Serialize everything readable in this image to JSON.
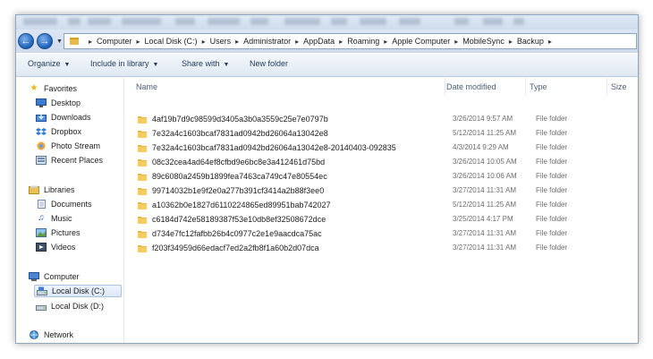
{
  "address": {
    "crumbs": [
      "Computer",
      "Local Disk (C:)",
      "Users",
      "Administrator",
      "AppData",
      "Roaming",
      "Apple Computer",
      "MobileSync",
      "Backup"
    ]
  },
  "toolbar": {
    "organize_label": "Organize",
    "include_label": "Include in library",
    "share_label": "Share with",
    "new_folder_label": "New folder"
  },
  "sidebar": {
    "favorites_label": "Favorites",
    "favorites": [
      {
        "label": "Desktop",
        "icon": "desktop-icon"
      },
      {
        "label": "Downloads",
        "icon": "downloads-icon"
      },
      {
        "label": "Dropbox",
        "icon": "dropbox-icon"
      },
      {
        "label": "Photo Stream",
        "icon": "photo-stream-icon"
      },
      {
        "label": "Recent Places",
        "icon": "recent-places-icon"
      }
    ],
    "libraries_label": "Libraries",
    "libraries": [
      {
        "label": "Documents",
        "icon": "documents-icon"
      },
      {
        "label": "Music",
        "icon": "music-icon"
      },
      {
        "label": "Pictures",
        "icon": "pictures-icon"
      },
      {
        "label": "Videos",
        "icon": "videos-icon"
      }
    ],
    "computer_label": "Computer",
    "computer": [
      {
        "label": "Local Disk (C:)",
        "icon": "drive-icon",
        "selected": true
      },
      {
        "label": "Local Disk (D:)",
        "icon": "drive-icon",
        "selected": false
      }
    ],
    "network_label": "Network"
  },
  "columns": {
    "name": "Name",
    "date": "Date modified",
    "type": "Type",
    "size": "Size"
  },
  "files": [
    {
      "name": "4af19b7d9c98599d3405a3b0a3559c25e7e0797b",
      "date": "3/26/2014 9:57 AM",
      "type": "File folder"
    },
    {
      "name": "7e32a4c1603bcaf7831ad0942bd26064a13042e8",
      "date": "5/12/2014 11:25 AM",
      "type": "File folder"
    },
    {
      "name": "7e32a4c1603bcaf7831ad0942bd26064a13042e8-20140403-092835",
      "date": "4/3/2014 9:29 AM",
      "type": "File folder"
    },
    {
      "name": "08c32cea4ad64ef8cfbd9e6bc8e3a412461d75bd",
      "date": "3/26/2014 10:05 AM",
      "type": "File folder"
    },
    {
      "name": "89c6080a2459b1899fea7463ca749c47e80554ec",
      "date": "3/26/2014 10:06 AM",
      "type": "File folder"
    },
    {
      "name": "99714032b1e9f2e0a277b391cf3414a2b88f3ee0",
      "date": "3/27/2014 11:31 AM",
      "type": "File folder"
    },
    {
      "name": "a10362b0e1827d6110224865ed89951bab742027",
      "date": "5/12/2014 11:25 AM",
      "type": "File folder"
    },
    {
      "name": "c6184d742e58189387f53e10db8ef32508672dce",
      "date": "3/25/2014 4:17 PM",
      "type": "File folder"
    },
    {
      "name": "d734e7fc12fafbb26b4c0977c2e1e9aacdca75ac",
      "date": "3/27/2014 11:31 AM",
      "type": "File folder"
    },
    {
      "name": "f203f34959d66edacf7ed2a2fb8f1a60b2d07dca",
      "date": "3/27/2014 11:31 AM",
      "type": "File folder"
    }
  ],
  "colors": {
    "accent": "#1e395b",
    "folder": "#e7b94a",
    "selection": "#dbe7f7"
  }
}
